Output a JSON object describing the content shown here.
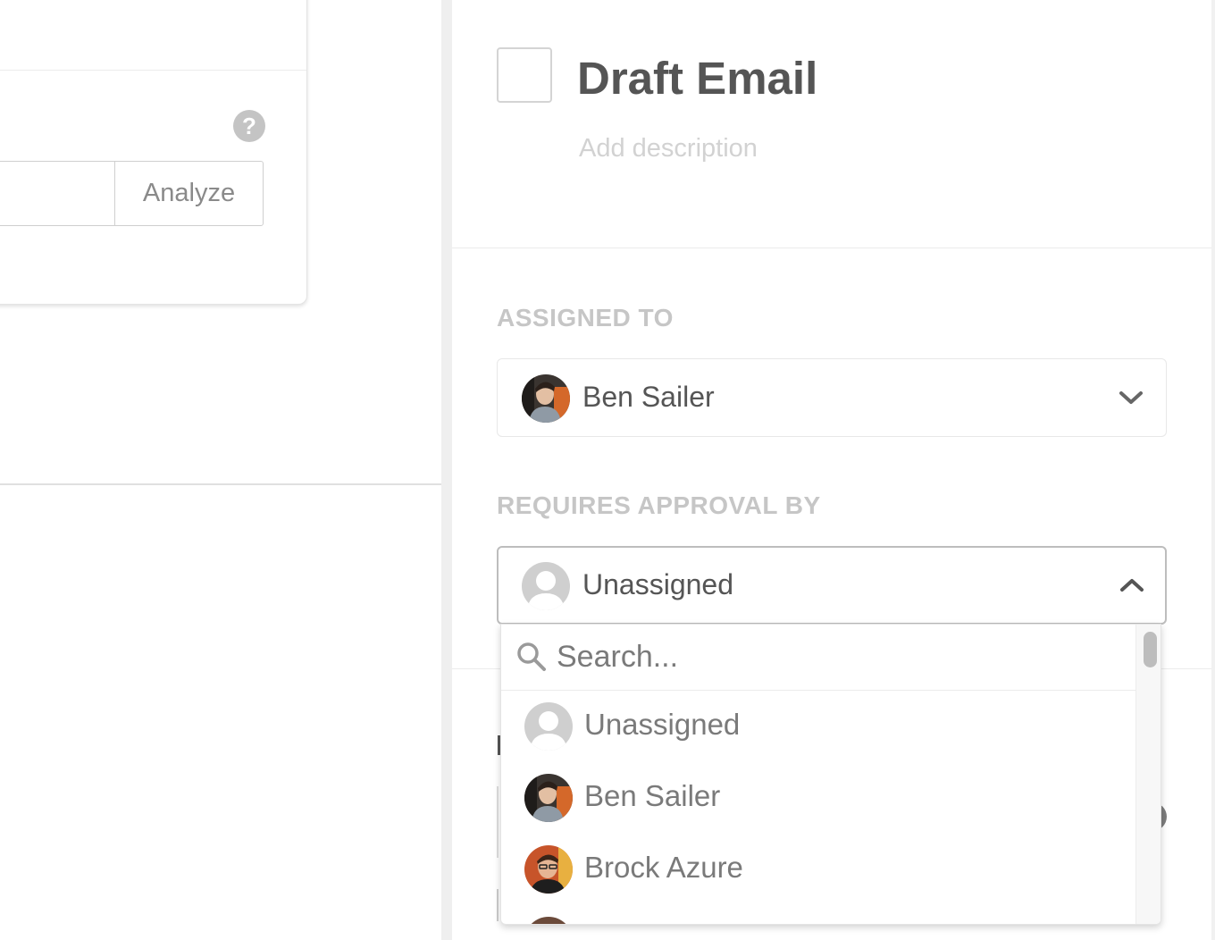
{
  "left_panel": {
    "help_icon_glyph": "?",
    "analyze_button_label": "Analyze",
    "analyze_input_value": ""
  },
  "task": {
    "title": "Draft Email",
    "description_placeholder": "Add description",
    "checked": false
  },
  "assigned_to": {
    "label": "ASSIGNED TO",
    "selected": "Ben Sailer",
    "avatar_icon": "user-photo-ben-sailer",
    "chevron_icon": "chevron-down-icon"
  },
  "requires_approval_by": {
    "label": "REQUIRES APPROVAL BY",
    "selected": "Unassigned",
    "avatar_icon": "default-user-icon",
    "chevron_icon": "chevron-up-icon"
  },
  "dropdown": {
    "search_placeholder": "Search...",
    "search_value": "",
    "options": [
      {
        "label": "Unassigned",
        "avatar_icon": "default-user-icon"
      },
      {
        "label": "Ben Sailer",
        "avatar_icon": "user-photo-ben-sailer"
      },
      {
        "label": "Brock Azure",
        "avatar_icon": "user-photo-brock-azure"
      }
    ]
  },
  "colors": {
    "text_primary": "#555555",
    "text_muted": "#c6c6c6",
    "border": "#e8e8e8",
    "gutter": "#efefef"
  }
}
